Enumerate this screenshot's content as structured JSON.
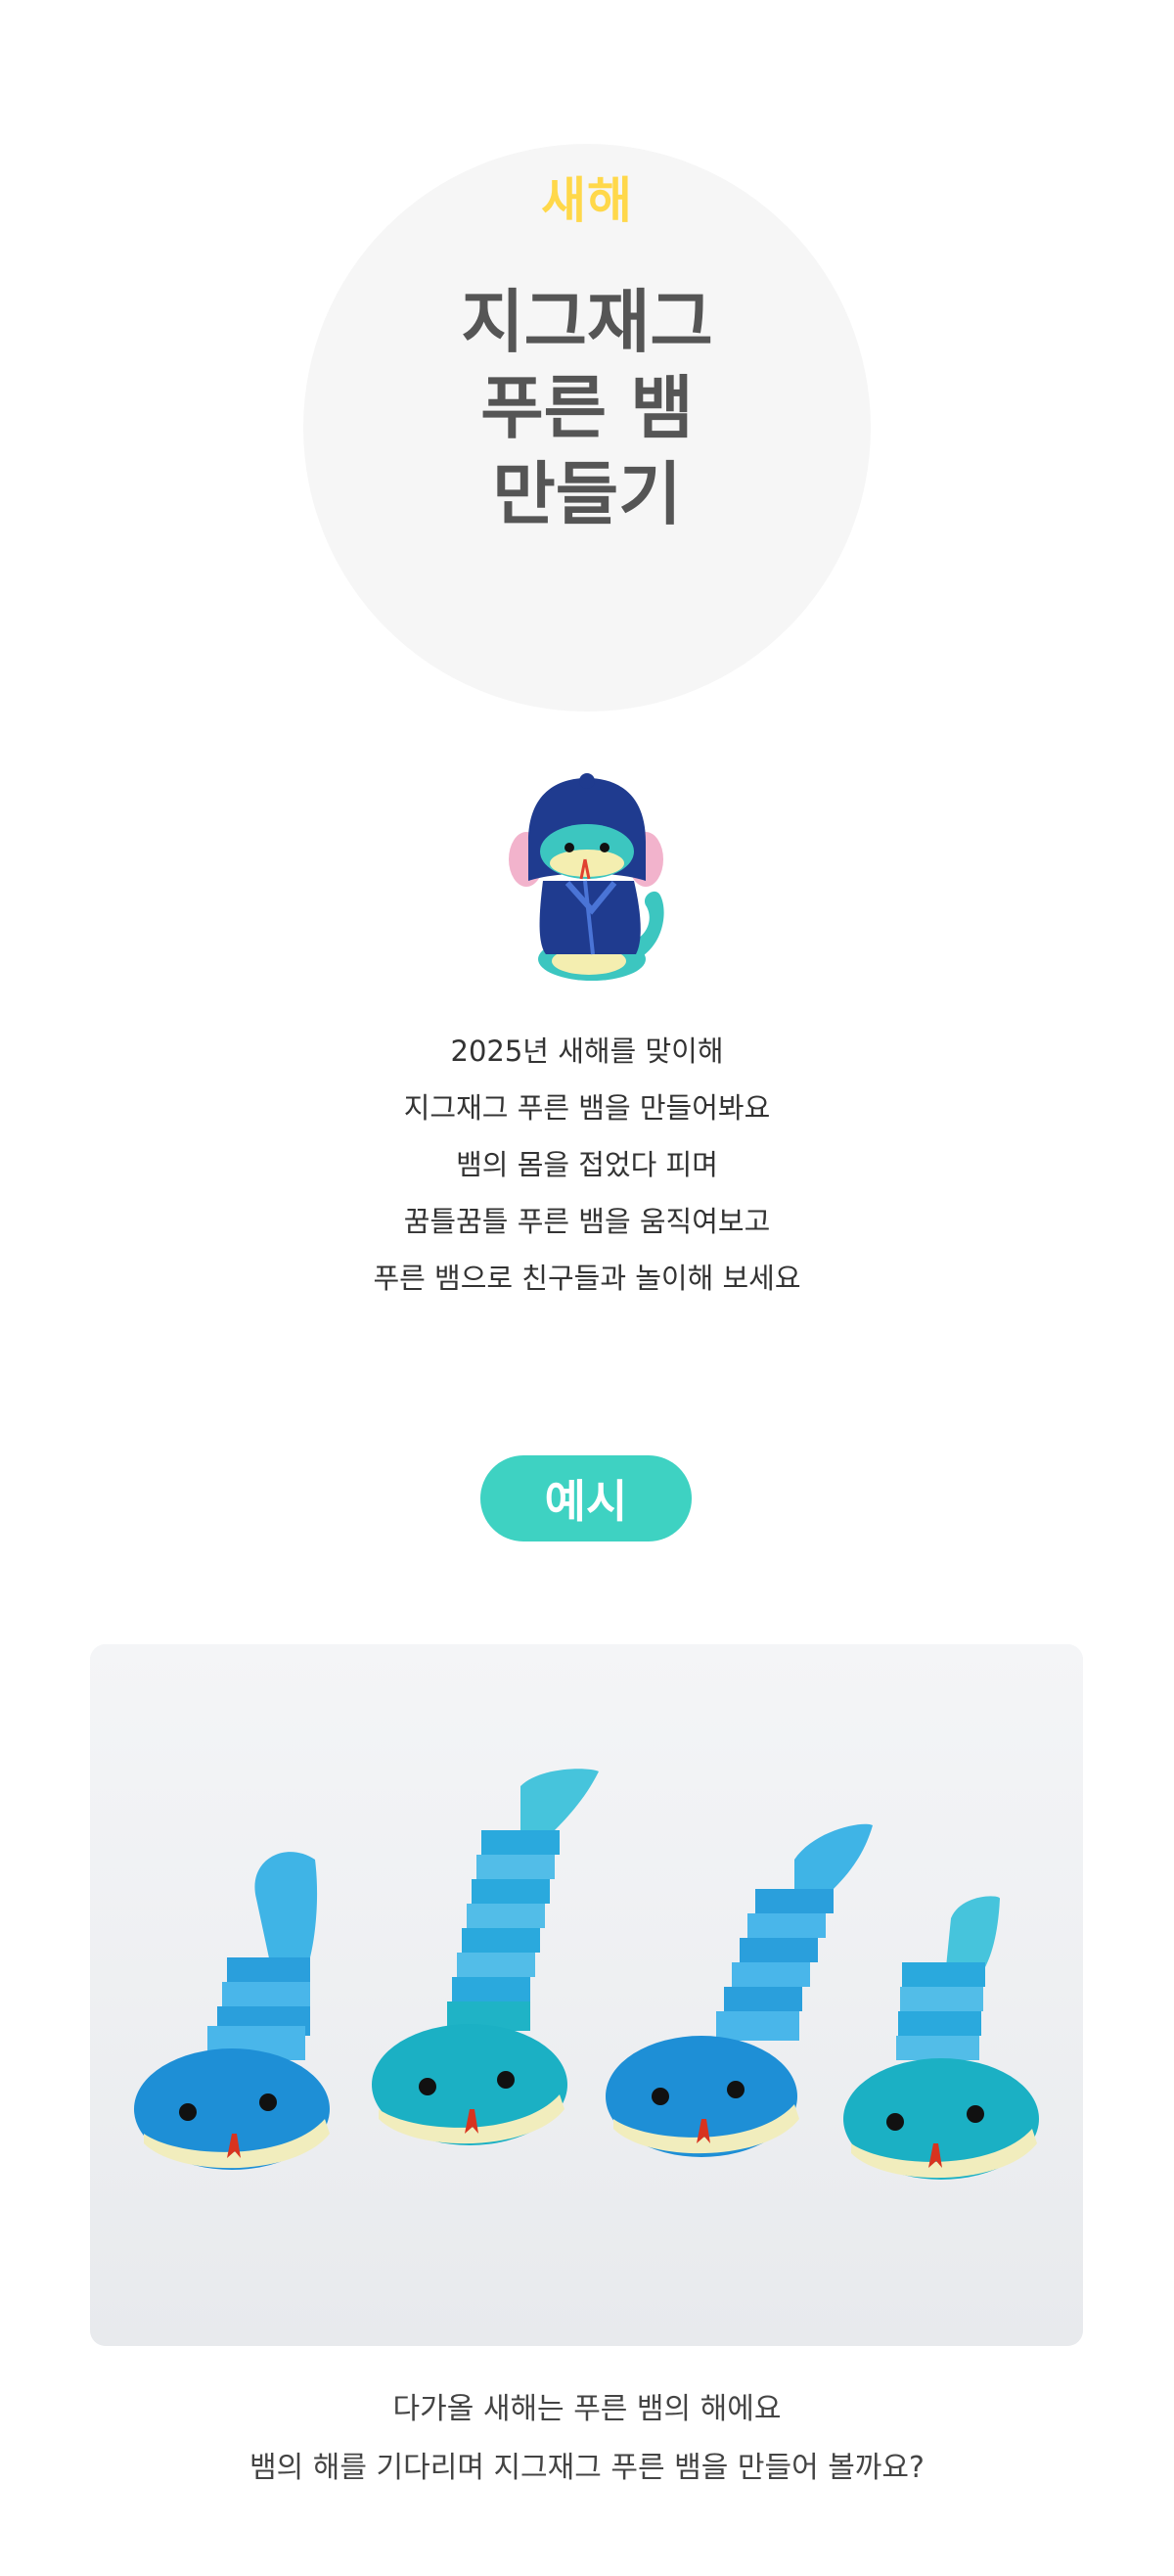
{
  "hero": {
    "kicker": "새해",
    "title_lines": [
      "지그재그",
      "푸른 뱀",
      "만들기"
    ]
  },
  "intro": {
    "lines": [
      "2025년 새해를 맞이해",
      "지그재그 푸른 뱀을 만들어봐요",
      "뱀의 몸을 접었다 피며",
      "꿈틀꿈틀 푸른 뱀을 움직여보고",
      "푸른 뱀으로 친구들과 놀이해 보세요"
    ]
  },
  "example": {
    "badge_label": "예시"
  },
  "caption": {
    "lines": [
      "다가올 새해는 푸른 뱀의 해에요",
      "뱀의 해를 기다리며 지그재그 푸른 뱀을 만들어 볼까요?"
    ]
  },
  "colors": {
    "kicker": "#ffd84a",
    "title": "#555555",
    "badge": "#3ed2c2",
    "snake_blue": "#1e8fd6",
    "snake_teal": "#1bb0c4",
    "snake_belly": "#f1edbd",
    "mascot_hood": "#1f3b8f"
  }
}
